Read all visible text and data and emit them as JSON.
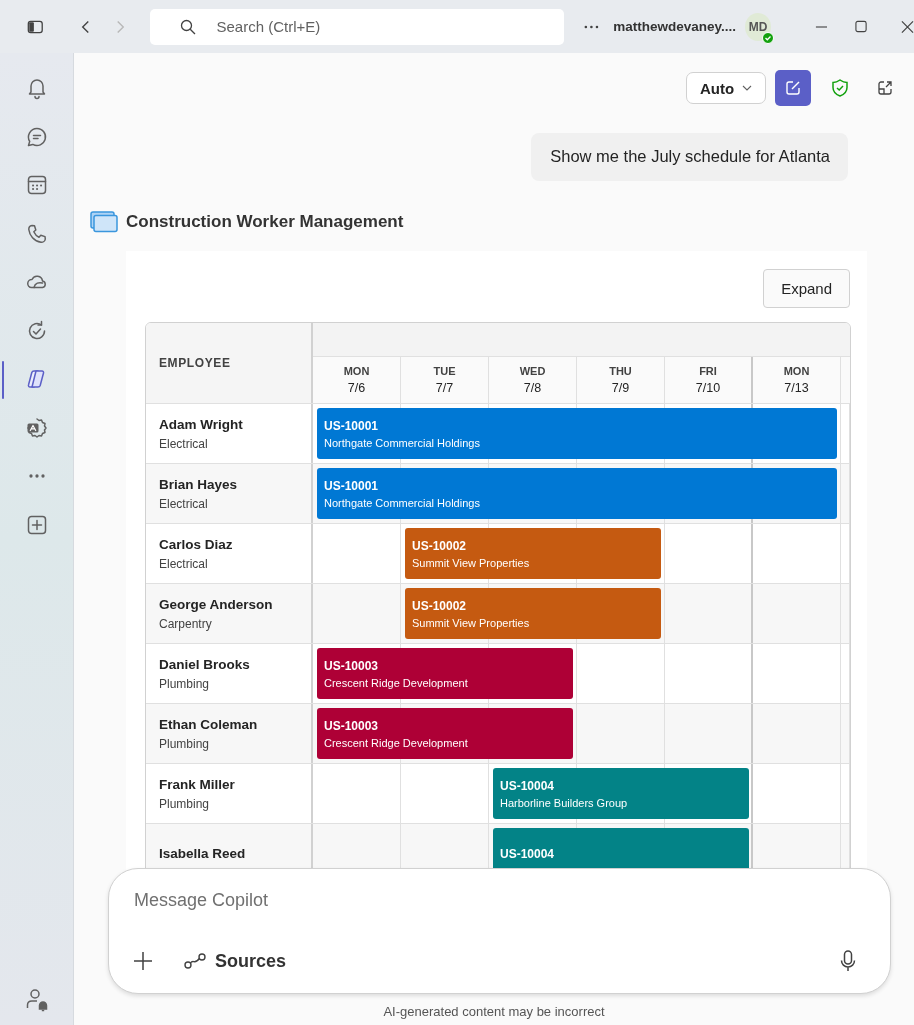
{
  "topbar": {
    "search": {
      "placeholder": "Search (Ctrl+E)"
    },
    "user_name": "matthewdevaney....",
    "avatar": {
      "initials": "MD",
      "online": true
    },
    "forward_disabled": true
  },
  "rail": {
    "items": [
      {
        "kind": "bell",
        "selected": false
      },
      {
        "kind": "chat",
        "selected": false
      },
      {
        "kind": "calendar",
        "selected": false
      },
      {
        "kind": "phone",
        "selected": false
      },
      {
        "kind": "cloud",
        "selected": false
      },
      {
        "kind": "refresh",
        "selected": false
      },
      {
        "kind": "copilot",
        "selected": true
      },
      {
        "kind": "apps",
        "selected": false
      },
      {
        "kind": "more",
        "selected": false
      },
      {
        "kind": "add",
        "selected": false
      }
    ]
  },
  "chat": {
    "mode_dropdown": {
      "value": "Auto"
    },
    "user_message": "Show me the July schedule for Atlanta",
    "card": {
      "title": "Construction Worker Management",
      "expand_button": "Expand",
      "schedule": {
        "employee_header": "EMPLOYEE",
        "days": [
          {
            "dow": "MON",
            "date": "7/6",
            "week_end": false
          },
          {
            "dow": "TUE",
            "date": "7/7",
            "week_end": false
          },
          {
            "dow": "WED",
            "date": "7/8",
            "week_end": false
          },
          {
            "dow": "THU",
            "date": "7/9",
            "week_end": false
          },
          {
            "dow": "FRI",
            "date": "7/10",
            "week_end": true
          },
          {
            "dow": "MON",
            "date": "7/13",
            "week_end": false
          }
        ],
        "rows": [
          {
            "name": "Adam Wright",
            "role": "Electrical",
            "bookings": [
              {
                "code": "US-10001",
                "client": "Northgate Commercial Holdings",
                "color": "#0078d4",
                "days": [
                  true,
                  true,
                  true,
                  true,
                  true,
                  true
                ]
              }
            ]
          },
          {
            "name": "Brian Hayes",
            "role": "Electrical",
            "bookings": [
              {
                "code": "US-10001",
                "client": "Northgate Commercial Holdings",
                "color": "#0078d4",
                "days": [
                  true,
                  true,
                  true,
                  true,
                  true,
                  true
                ]
              }
            ]
          },
          {
            "name": "Carlos Diaz",
            "role": "Electrical",
            "bookings": [
              {
                "code": "US-10002",
                "client": "Summit View Properties",
                "color": "#c55a11",
                "days": [
                  false,
                  true,
                  true,
                  true,
                  false,
                  false
                ]
              }
            ]
          },
          {
            "name": "George Anderson",
            "role": "Carpentry",
            "bookings": [
              {
                "code": "US-10002",
                "client": "Summit View Properties",
                "color": "#c55a11",
                "days": [
                  false,
                  true,
                  true,
                  true,
                  false,
                  false
                ]
              }
            ]
          },
          {
            "name": "Daniel Brooks",
            "role": "Plumbing",
            "bookings": [
              {
                "code": "US-10003",
                "client": "Crescent Ridge Development",
                "color": "#ae0036",
                "days": [
                  true,
                  true,
                  true,
                  false,
                  false,
                  false
                ]
              }
            ]
          },
          {
            "name": "Ethan Coleman",
            "role": "Plumbing",
            "bookings": [
              {
                "code": "US-10003",
                "client": "Crescent Ridge Development",
                "color": "#ae0036",
                "days": [
                  true,
                  true,
                  true,
                  false,
                  false,
                  false
                ]
              }
            ]
          },
          {
            "name": "Frank Miller",
            "role": "Plumbing",
            "bookings": [
              {
                "code": "US-10004",
                "client": "Harborline Builders Group",
                "color": "#038387",
                "days": [
                  false,
                  false,
                  true,
                  true,
                  true,
                  false
                ]
              }
            ]
          },
          {
            "name": "Isabella Reed",
            "bookings": [
              {
                "code": "US-10004",
                "color": "#038387",
                "days": [
                  false,
                  false,
                  true,
                  true,
                  true,
                  false
                ]
              }
            ]
          }
        ]
      }
    }
  },
  "composer": {
    "placeholder": "Message Copilot",
    "sources_button": "Sources",
    "disclaimer": "AI-generated content may be incorrect"
  }
}
